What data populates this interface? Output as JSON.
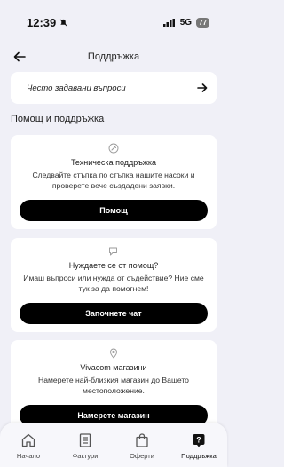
{
  "status": {
    "time": "12:39",
    "network": "5G",
    "battery": "77"
  },
  "header": {
    "title": "Поддръжка"
  },
  "faq": {
    "label": "Често задавани въпроси"
  },
  "section": {
    "title": "Помощ и поддръжка"
  },
  "cards": [
    {
      "icon": "wrench-icon",
      "title": "Техническа поддръжка",
      "text": "Следвайте стъпка по стъпка нашите насоки и проверете вече създадени заявки.",
      "button": "Помощ"
    },
    {
      "icon": "chat-icon",
      "title": "Нуждаете се от помощ?",
      "text": "Имаш въпроси или нужда от съдействие? Ние сме тук за да помогнем!",
      "button": "Започнете чат"
    },
    {
      "icon": "location-pin-icon",
      "title": "Vivacom магазини",
      "text": "Намерете най-близкия магазин до Вашето местоположение.",
      "button": "Намерете магазин"
    }
  ],
  "tabs": [
    {
      "label": "Начало",
      "icon": "home-icon"
    },
    {
      "label": "Фактури",
      "icon": "invoice-icon"
    },
    {
      "label": "Оферти",
      "icon": "shopping-bag-icon"
    },
    {
      "label": "Поддръжка",
      "icon": "help-icon",
      "active": true
    }
  ]
}
